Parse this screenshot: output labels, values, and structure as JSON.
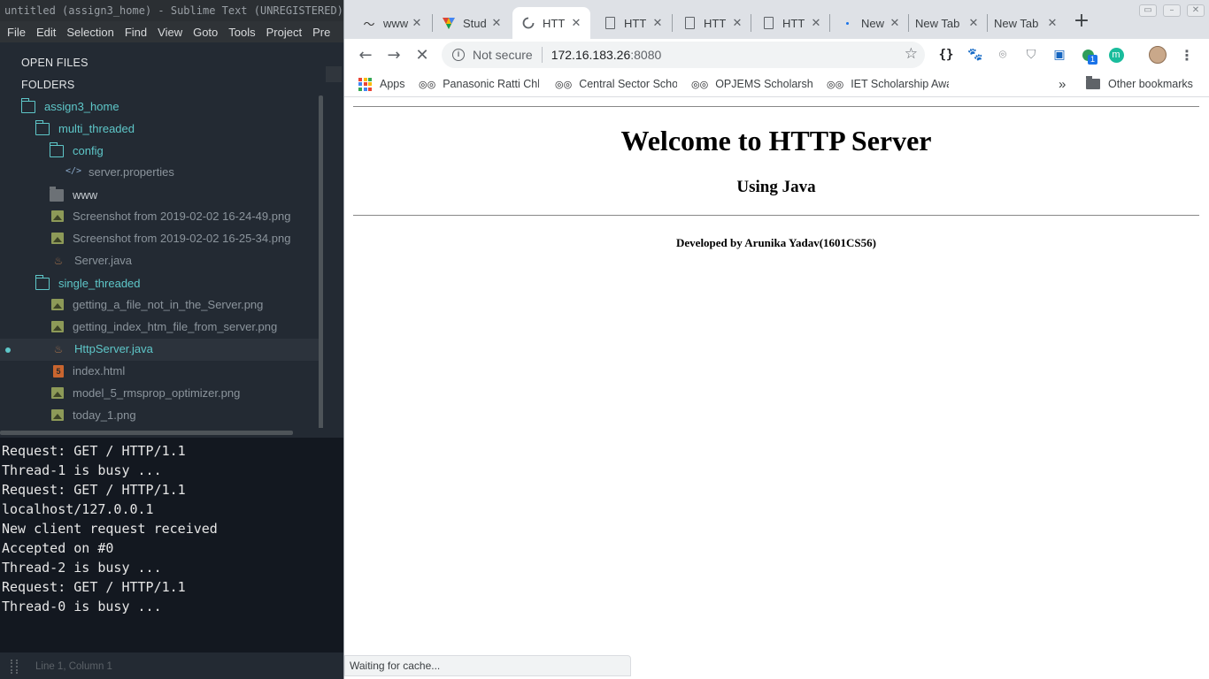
{
  "sublime": {
    "title": "untitled (assign3_home) - Sublime Text (UNREGISTERED)",
    "menu": [
      "File",
      "Edit",
      "Selection",
      "Find",
      "View",
      "Goto",
      "Tools",
      "Project",
      "Pre"
    ],
    "sidebar": {
      "open_files_label": "OPEN FILES",
      "folders_label": "FOLDERS",
      "tree": [
        {
          "label": "assign3_home",
          "type": "folder-open",
          "depth": 0
        },
        {
          "label": "multi_threaded",
          "type": "folder-open",
          "depth": 1
        },
        {
          "label": "config",
          "type": "folder-open",
          "depth": 2
        },
        {
          "label": "server.properties",
          "type": "code-file",
          "depth": 3
        },
        {
          "label": "www",
          "type": "folder-closed",
          "depth": 2
        },
        {
          "label": "Screenshot from 2019-02-02 16-24-49.png",
          "type": "image-file",
          "depth": 2
        },
        {
          "label": "Screenshot from 2019-02-02 16-25-34.png",
          "type": "image-file",
          "depth": 2
        },
        {
          "label": "Server.java",
          "type": "java-file",
          "depth": 2
        },
        {
          "label": "single_threaded",
          "type": "folder-open",
          "depth": 1
        },
        {
          "label": "getting_a_file_not_in_the_Server.png",
          "type": "image-file",
          "depth": 2
        },
        {
          "label": "getting_index_htm_file_from_server.png",
          "type": "image-file",
          "depth": 2
        },
        {
          "label": "HttpServer.java",
          "type": "java-file",
          "depth": 2,
          "selected": true
        },
        {
          "label": "index.html",
          "type": "html-file",
          "depth": 2
        },
        {
          "label": "model_5_rmsprop_optimizer.png",
          "type": "image-file",
          "depth": 2
        },
        {
          "label": "today_1.png",
          "type": "image-file",
          "depth": 2
        }
      ]
    },
    "console_lines": [
      "Request: GET / HTTP/1.1",
      "Thread-1 is busy ...",
      "Request: GET / HTTP/1.1",
      "localhost/127.0.0.1",
      "New client request received",
      "Accepted on #0",
      "Thread-2 is busy ...",
      "Request: GET / HTTP/1.1",
      "Thread-0 is busy ..."
    ],
    "status": "Line 1, Column 1"
  },
  "chrome": {
    "tabs": [
      {
        "label": "www",
        "icon": "swan-icon",
        "active": false
      },
      {
        "label": "Stud",
        "icon": "colorful-logo-icon",
        "active": false
      },
      {
        "label": "HTT",
        "icon": "loading-spinner-icon",
        "active": true
      },
      {
        "label": "HTT",
        "icon": "document-icon",
        "active": false
      },
      {
        "label": "HTT",
        "icon": "document-icon",
        "active": false
      },
      {
        "label": "HTT",
        "icon": "document-icon",
        "active": false
      },
      {
        "label": "New",
        "icon": "blue-dot-icon",
        "active": false
      },
      {
        "label": "New Tab",
        "icon": "",
        "active": false
      },
      {
        "label": "New Tab",
        "icon": "",
        "active": false
      }
    ],
    "omnibox": {
      "security_label": "Not secure",
      "host": "172.16.183.26",
      "port": ":8080"
    },
    "extensions_badge": "1",
    "avatar_letter": "m",
    "bookmarks": [
      {
        "label": "Apps",
        "icon": "apps-grid-icon"
      },
      {
        "label": "Panasonic Ratti Chh",
        "icon": "glasses-icon"
      },
      {
        "label": "Central Sector Scho",
        "icon": "glasses-icon"
      },
      {
        "label": "OPJEMS Scholarship",
        "icon": "glasses-icon"
      },
      {
        "label": "IET Scholarship Awa",
        "icon": "glasses-icon"
      }
    ],
    "bookmarks_overflow": "»",
    "other_bookmarks": "Other bookmarks",
    "page": {
      "heading": "Welcome to HTTP Server",
      "subheading": "Using Java",
      "developer": "Developed by Arunika Yadav(1601CS56)"
    },
    "status_text": "Waiting for cache..."
  }
}
